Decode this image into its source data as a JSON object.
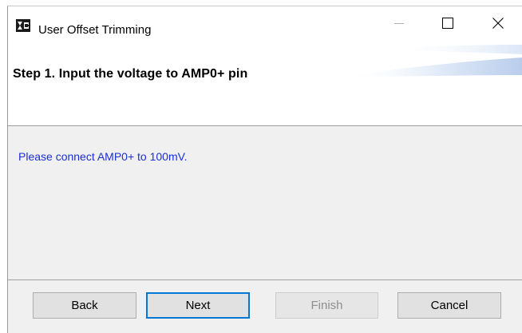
{
  "window": {
    "title": "User Offset Trimming",
    "icon": "app-logo-icon",
    "controls": {
      "minimize": "minimize-icon",
      "maximize": "maximize-icon",
      "close": "close-icon"
    }
  },
  "header": {
    "step_title": "Step 1. Input the voltage to AMP0+ pin"
  },
  "content": {
    "message": "Please connect AMP0+ to 100mV.",
    "message_color": "#1c2fd4"
  },
  "buttons": {
    "back": {
      "label": "Back",
      "enabled": true
    },
    "next": {
      "label": "Next",
      "enabled": true,
      "focused": true
    },
    "finish": {
      "label": "Finish",
      "enabled": false
    },
    "cancel": {
      "label": "Cancel",
      "enabled": true
    }
  },
  "colors": {
    "focus_border": "#0078d7",
    "dialog_background": "#f0f0f0"
  }
}
